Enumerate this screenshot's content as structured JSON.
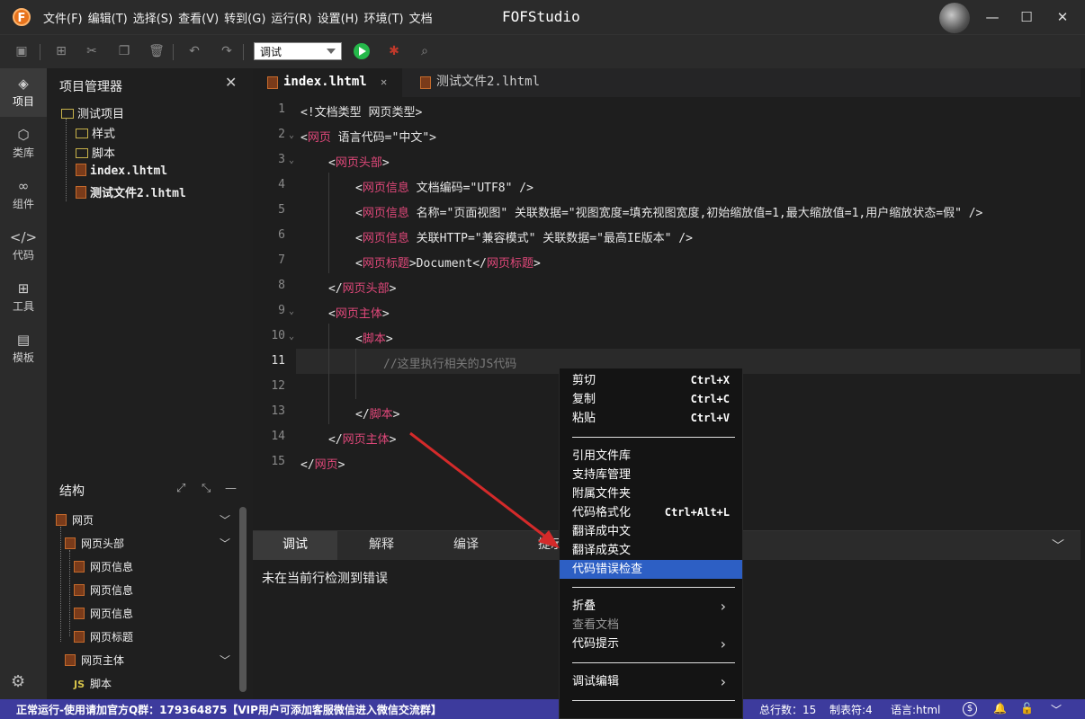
{
  "window": {
    "app_title": "FOFStudio",
    "logo_letter": "F",
    "menu": [
      "文件(F)",
      "编辑(T)",
      "选择(S)",
      "查看(V)",
      "转到(G)",
      "运行(R)",
      "设置(H)",
      "环境(T)",
      "文档"
    ],
    "controls": {
      "minimize": "—",
      "maximize": "☐",
      "close": "✕"
    }
  },
  "toolbar": {
    "mode_value": "调试",
    "icons": [
      "save-icon",
      "new-file-icon",
      "cut-icon",
      "copy-icon",
      "delete-icon",
      "undo-icon",
      "redo-icon",
      "run-icon",
      "debug-bug-icon",
      "find-icon"
    ]
  },
  "activity_bar": {
    "items": [
      {
        "label": "项目",
        "icon": "layers-icon",
        "glyph": "◈"
      },
      {
        "label": "类库",
        "icon": "cube-icon",
        "glyph": "⬡"
      },
      {
        "label": "组件",
        "icon": "link-icon",
        "glyph": "∞"
      },
      {
        "label": "代码",
        "icon": "code-icon",
        "glyph": "</>"
      },
      {
        "label": "工具",
        "icon": "tools-icon",
        "glyph": "⊞"
      },
      {
        "label": "模板",
        "icon": "template-icon",
        "glyph": "▤"
      }
    ],
    "settings_glyph": "⚙"
  },
  "explorer": {
    "title": "项目管理器",
    "close": "✕",
    "project": "测试项目",
    "items": [
      "样式",
      "脚本",
      "index.lhtml",
      "测试文件2.lhtml"
    ]
  },
  "structure": {
    "title": "结构",
    "nodes": [
      "网页",
      "网页头部",
      "网页信息",
      "网页信息",
      "网页信息",
      "网页标题",
      "网页主体",
      "脚本"
    ],
    "js_badge": "JS"
  },
  "tabs": [
    {
      "label": "index.lhtml",
      "close": "✕"
    },
    {
      "label": "测试文件2.lhtml"
    }
  ],
  "code": {
    "line_numbers": [
      "1",
      "2",
      "3",
      "4",
      "5",
      "6",
      "7",
      "8",
      "9",
      "10",
      "11",
      "12",
      "13",
      "14",
      "15"
    ],
    "lines": [
      "<!文档类型 网页类型>",
      "<网页 语言代码=\"中文\">",
      "<网页头部>",
      "<网页信息 文档编码=\"UTF8\" />",
      "<网页信息 名称=\"页面视图\" 关联数据=\"视图宽度=填充视图宽度,初始缩放值=1,最大缩放值=1,用户缩放状态=假\" />",
      "<网页信息 关联HTTP=\"兼容模式\" 关联数据=\"最高IE版本\" />",
      "<网页标题>Document</网页标题>",
      "</网页头部>",
      "<网页主体>",
      "<脚本>",
      "//这里执行相关的JS代码",
      "",
      "</脚本>",
      "</网页主体>",
      "</网页>"
    ]
  },
  "panel": {
    "tabs": [
      "调试",
      "解释",
      "编译",
      "提示"
    ],
    "message": "未在当前行检测到错误"
  },
  "context_menu": {
    "items": [
      {
        "label": "剪切",
        "shortcut": "Ctrl+X"
      },
      {
        "label": "复制",
        "shortcut": "Ctrl+C"
      },
      {
        "label": "粘贴",
        "shortcut": "Ctrl+V"
      },
      {
        "label": "引用文件库"
      },
      {
        "label": "支持库管理"
      },
      {
        "label": "附属文件夹"
      },
      {
        "label": "代码格式化",
        "shortcut": "Ctrl+Alt+L"
      },
      {
        "label": "翻译成中文"
      },
      {
        "label": "翻译成英文"
      },
      {
        "label": "代码错误检查"
      },
      {
        "label": "折叠",
        "submenu": "›"
      },
      {
        "label": "查看文档"
      },
      {
        "label": "代码提示",
        "submenu": "›"
      },
      {
        "label": "调试编辑",
        "submenu": "›"
      }
    ]
  },
  "statusbar": {
    "message": "正常运行-使用请加官方Q群：179364875【VIP用户可添加客服微信进入微信交流群】",
    "total_lines": "总行数：15",
    "tab_chars": "制表符:4",
    "language": "语言:html"
  },
  "colors": {
    "accent": "#3d3b9d",
    "highlight": "#2d5fc4",
    "tag": "#e0487a",
    "attr": "#d6c34a",
    "run": "#25b84a",
    "arrow": "#d42a2a"
  }
}
